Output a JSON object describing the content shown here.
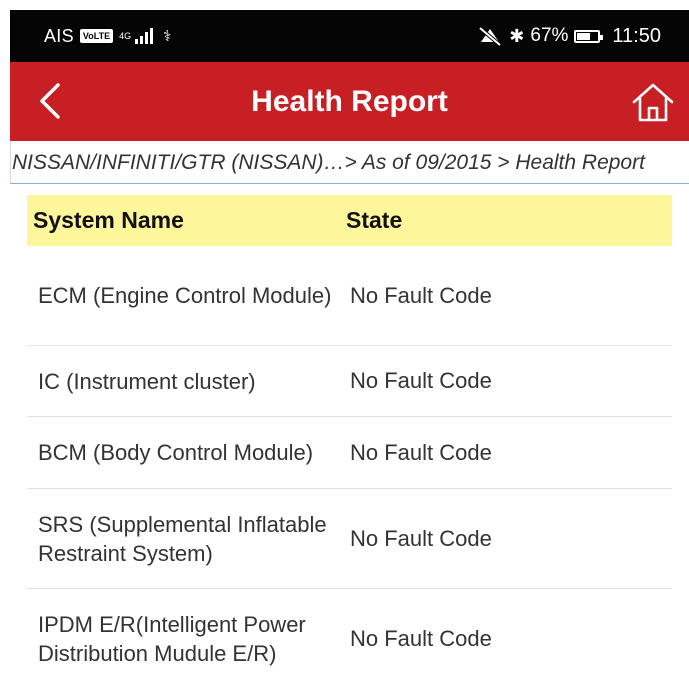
{
  "status_bar": {
    "carrier": "AIS",
    "volte": "VoLTE",
    "network": "4G",
    "battery_percent": "67%",
    "battery_level": 0.67,
    "time": "11:50",
    "bluetooth_glyph": "✱"
  },
  "app_bar": {
    "title": "Health Report",
    "bg_color": "#c81f24"
  },
  "breadcrumb": {
    "text": "NISSAN/INFINITI/GTR (NISSAN)…> As of 09/2015 > Health Report"
  },
  "table": {
    "header_bg": "#fdf69a",
    "columns": [
      "System Name",
      "State"
    ],
    "rows": [
      {
        "system": "ECM (Engine Control Module)",
        "state": "No Fault Code"
      },
      {
        "system": "IC (Instrument cluster)",
        "state": "No Fault Code"
      },
      {
        "system": "BCM (Body Control Module)",
        "state": "No Fault Code"
      },
      {
        "system": "SRS (Supplemental Inflatable Restraint System)",
        "state": "No Fault Code"
      },
      {
        "system": "IPDM E/R(Intelligent Power Distribution Mudule E/R)",
        "state": "No Fault Code"
      }
    ]
  }
}
